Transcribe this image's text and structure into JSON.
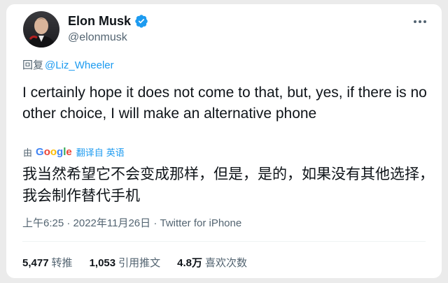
{
  "author": {
    "display_name": "Elon Musk",
    "handle": "@elonmusk",
    "verified_icon": "verified-badge-icon",
    "avatar": "profile-photo"
  },
  "reply": {
    "prefix": "回复",
    "mention": "@Liz_Wheeler"
  },
  "tweet": {
    "text": "I certainly hope it does not come to that, but, yes, if there is no other choice, I will make an alternative phone"
  },
  "translation": {
    "by_label": "由",
    "provider": "Google",
    "link_text": "翻译自",
    "source_language": "英语",
    "text": "我当然希望它不会变成那样，但是，是的，如果没有其他选择，我会制作替代手机"
  },
  "meta": {
    "timestamp": "上午6:25 · 2022年11月26日 · Twitter for iPhone"
  },
  "stats": {
    "retweets_count": "5,477",
    "retweets_label": "转推",
    "quotes_count": "1,053",
    "quotes_label": "引用推文",
    "likes_count": "4.8万",
    "likes_label": "喜欢次数"
  },
  "colors": {
    "accent": "#1d9bf0",
    "text_primary": "#0f1419",
    "text_secondary": "#536471",
    "page_background": "#ebebeb"
  }
}
